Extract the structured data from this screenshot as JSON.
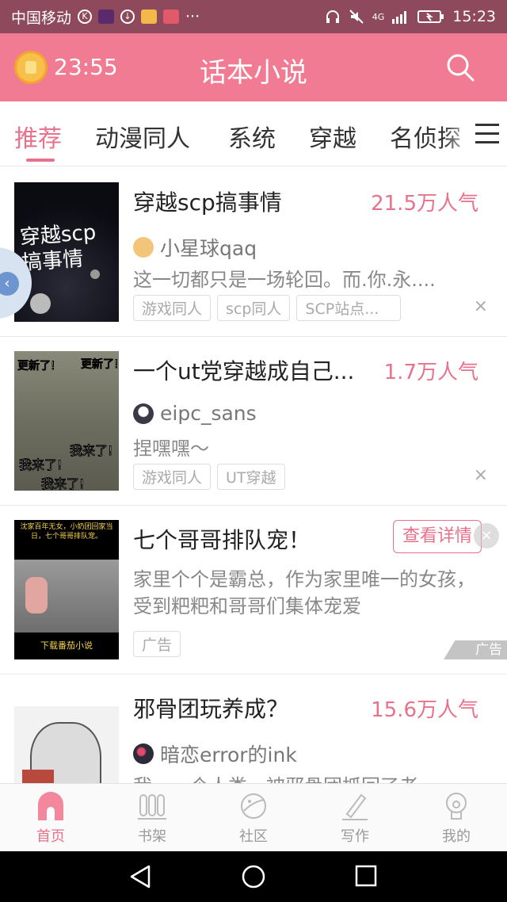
{
  "status_bar": {
    "carrier": "中国移动",
    "time": "15:23",
    "network": "4G"
  },
  "header": {
    "timer": "23:55",
    "title": "话本小说"
  },
  "tabs": [
    {
      "label": "推荐",
      "active": true
    },
    {
      "label": "动漫同人",
      "active": false
    },
    {
      "label": "系统",
      "active": false
    },
    {
      "label": "穿越",
      "active": false
    },
    {
      "label": "名侦探",
      "active": false
    }
  ],
  "feed": [
    {
      "title": "穿越scp搞事情",
      "popularity": "21.5万人气",
      "author": "小星球qaq",
      "description": "这一切都只是一场轮回。而.你.永....",
      "tags": [
        "游戏同人",
        "scp同人",
        "SCP站点..."
      ],
      "cover_text": "穿越scp\n搞事情",
      "close": "×"
    },
    {
      "title": "一个ut党穿越成自己...",
      "popularity": "1.7万人气",
      "author": "eipc_sans",
      "description": "捏嘿嘿～",
      "tags": [
        "游戏同人",
        "UT穿越"
      ],
      "cover_text": "更新了!",
      "cover_text2": "我来了!",
      "close": "×"
    },
    {
      "title": "七个哥哥排队宠！",
      "button": "查看详情",
      "description": "家里个个是霸总，作为家里唯一的女孩，受到粑粑和哥哥们集体宠爱",
      "tags": [
        "广告"
      ],
      "ad_label": "广告",
      "cover_text": "沈家百年无女，小奶团回家当日，七个哥哥排队宠。",
      "cover_bottom": "下载番茄小说",
      "close": "×"
    },
    {
      "title": "邪骨团玩养成？",
      "popularity": "15.6万人气",
      "author": "暗恋error的ink",
      "description": "我，一个人类，被邪骨团抓回了老..."
    }
  ],
  "bottom_nav": [
    {
      "label": "首页",
      "icon": "home-icon",
      "active": true
    },
    {
      "label": "书架",
      "icon": "bookshelf-icon",
      "active": false
    },
    {
      "label": "社区",
      "icon": "planet-icon",
      "active": false
    },
    {
      "label": "写作",
      "icon": "pen-icon",
      "active": false
    },
    {
      "label": "我的",
      "icon": "profile-icon",
      "active": false
    }
  ],
  "colors": {
    "accent": "#e8728b",
    "header": "#f07b93",
    "status_bar": "#8e4a5c"
  }
}
